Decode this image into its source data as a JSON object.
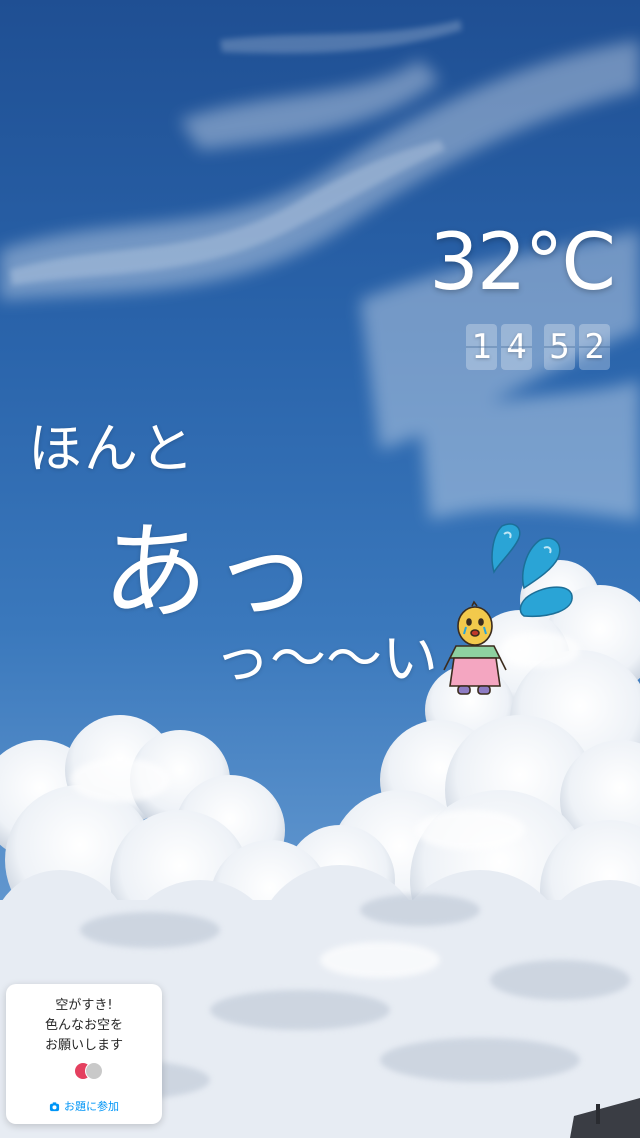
{
  "story": {
    "temperature": "32°C",
    "time_digits": [
      "1",
      "4",
      "5",
      "2"
    ],
    "caption_lines": [
      "ほんと",
      "あっ",
      "っ〜〜い"
    ],
    "question_sticker": {
      "lines": [
        "空がすき!",
        "色んなお空を",
        "お願いします"
      ],
      "join_label": "お題に参加",
      "join_icon": "camera-icon"
    },
    "sticker_icons": [
      "sweat-drops-icon",
      "crying-character-icon"
    ],
    "colors": {
      "sky_top": "#1f4f93",
      "sky_bottom": "#7ea9d6",
      "text": "#ffffff",
      "join_accent": "#0095f6",
      "drops": "#2aa4d6"
    }
  }
}
